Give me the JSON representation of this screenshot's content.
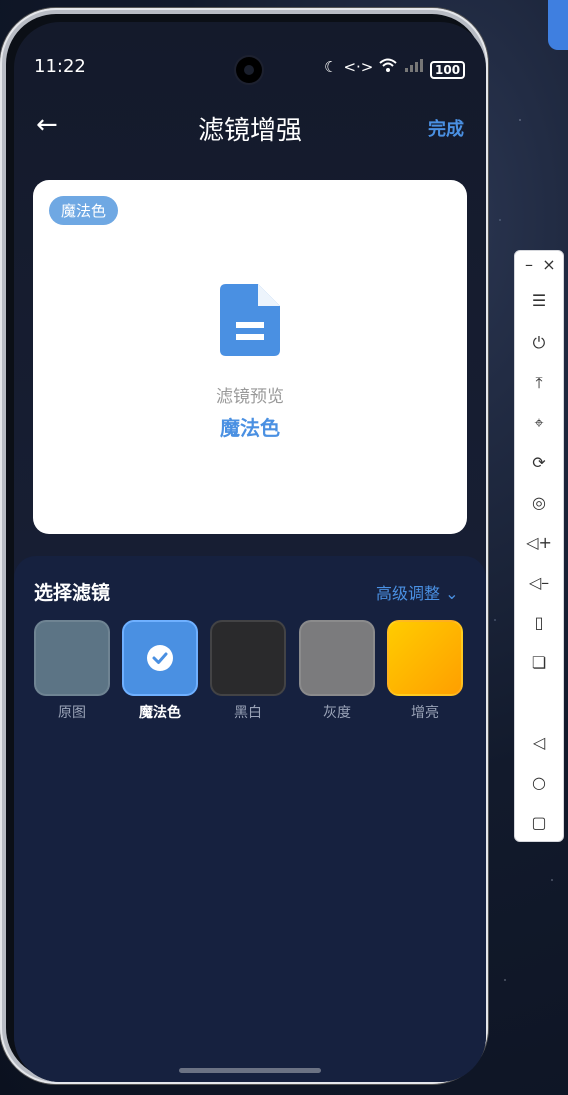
{
  "status_bar": {
    "time": "11:22",
    "battery": "100"
  },
  "header": {
    "title": "滤镜增强",
    "done_label": "完成"
  },
  "preview": {
    "badge": "魔法色",
    "label": "滤镜预览",
    "filter_name": "魔法色"
  },
  "filter_panel": {
    "title": "选择滤镜",
    "advanced_label": "高级调整",
    "filters": [
      {
        "label": "原图",
        "color": "#5c7485",
        "selected": false
      },
      {
        "label": "魔法色",
        "color": "#4a90e2",
        "selected": true
      },
      {
        "label": "黑白",
        "color": "#2a2a2c",
        "selected": false
      },
      {
        "label": "灰度",
        "color": "#7b7b7d",
        "selected": false
      },
      {
        "label": "增亮",
        "color": "#ffb000",
        "selected": false
      }
    ]
  },
  "toolbar": {
    "buttons": [
      "minimize-icon",
      "close-icon",
      "menu-icon",
      "power-icon",
      "pin-top-icon",
      "crop-icon",
      "rotate-icon",
      "screenshot-icon",
      "volume-up-icon",
      "volume-down-icon",
      "rotate-device-icon",
      "multi-window-icon",
      "back-icon",
      "home-icon",
      "recents-icon"
    ]
  },
  "colors": {
    "accent": "#4a90e2",
    "panel": "#16213f",
    "card": "#ffffff"
  }
}
